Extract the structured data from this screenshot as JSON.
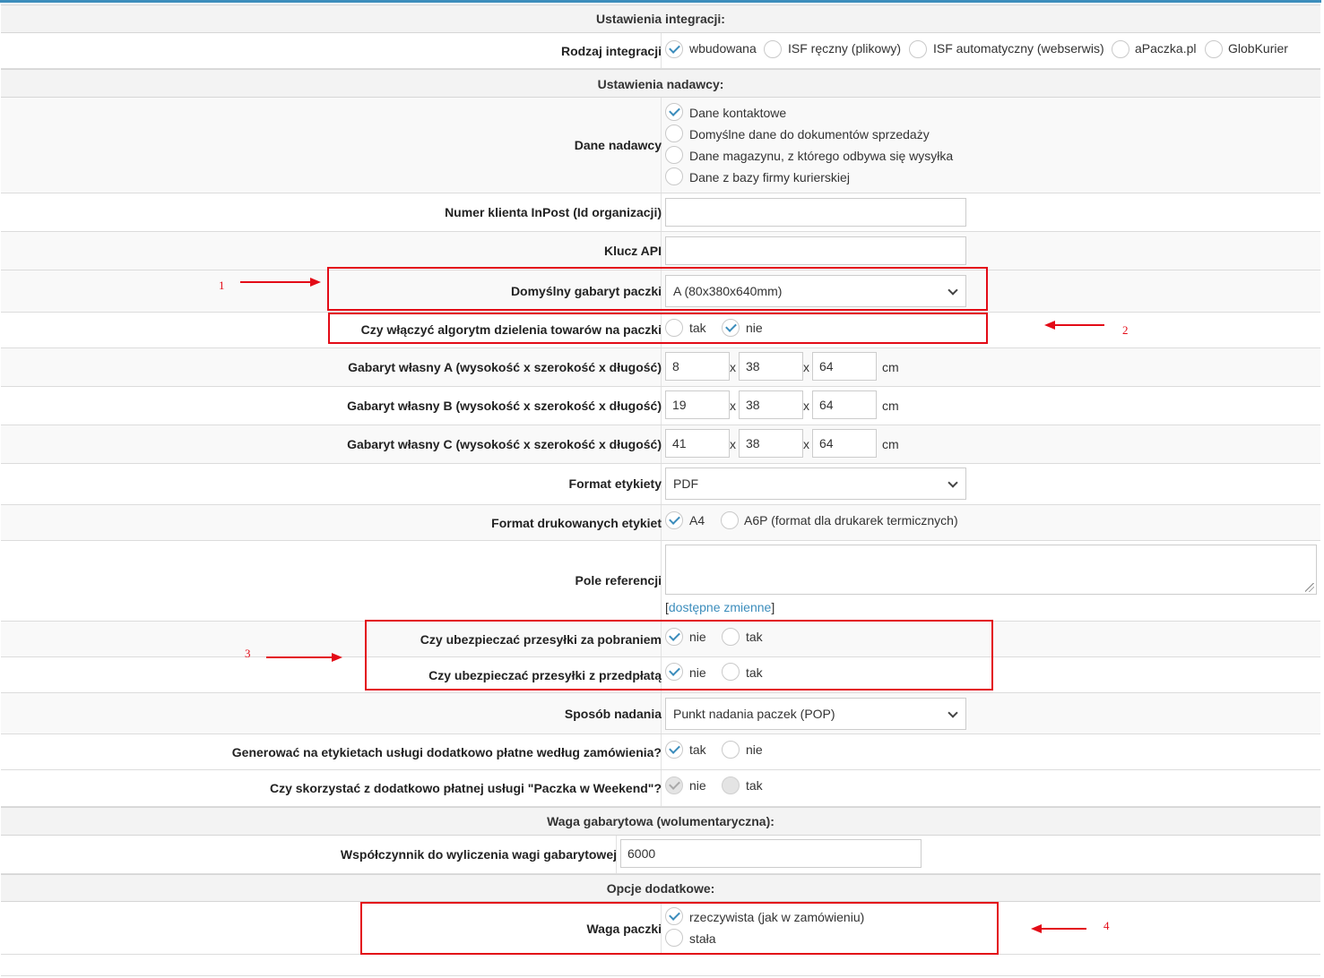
{
  "sections": {
    "integration": "Ustawienia integracji:",
    "sender": "Ustawienia nadawcy:",
    "dim_weight": "Waga gabarytowa (wolumentaryczna):",
    "extra": "Opcje dodatkowe:"
  },
  "integration_type": {
    "label": "Rodzaj integracji",
    "options": [
      "wbudowana",
      "ISF ręczny (plikowy)",
      "ISF automatyczny (webserwis)",
      "aPaczka.pl",
      "GlobKurier"
    ],
    "selected": "wbudowana"
  },
  "sender_data": {
    "label": "Dane nadawcy",
    "options": [
      "Dane kontaktowe",
      "Domyślne dane do dokumentów sprzedaży",
      "Dane magazynu, z którego odbywa się wysyłka",
      "Dane z bazy firmy kurierskiej"
    ],
    "selected": "Dane kontaktowe"
  },
  "client_number": {
    "label": "Numer klienta InPost (Id organizacji)",
    "value": ""
  },
  "api_key": {
    "label": "Klucz API",
    "value": ""
  },
  "default_size": {
    "label": "Domyślny gabaryt paczki",
    "value": "A (80x380x640mm)"
  },
  "split_algorithm": {
    "label": "Czy włączyć algorytm dzielenia towarów na paczki",
    "options": [
      "tak",
      "nie"
    ],
    "selected": "nie"
  },
  "custom_sizes": {
    "separator": "x",
    "unit": "cm",
    "items": [
      {
        "label": "Gabaryt własny A (wysokość x szerokość x długość)",
        "values": [
          "8",
          "38",
          "64"
        ]
      },
      {
        "label": "Gabaryt własny B (wysokość x szerokość x długość)",
        "values": [
          "19",
          "38",
          "64"
        ]
      },
      {
        "label": "Gabaryt własny C (wysokość x szerokość x długość)",
        "values": [
          "41",
          "38",
          "64"
        ]
      }
    ]
  },
  "label_format": {
    "label": "Format etykiety",
    "value": "PDF"
  },
  "print_format": {
    "label": "Format drukowanych etykiet",
    "options": [
      "A4",
      "A6P (format dla drukarek termicznych)"
    ],
    "selected": "A4"
  },
  "reference": {
    "label": "Pole referencji",
    "value": "",
    "link_open": "[",
    "link_text": "dostępne zmienne",
    "link_close": "]"
  },
  "insure_cod": {
    "label": "Czy ubezpieczać przesyłki za pobraniem",
    "options": [
      "nie",
      "tak"
    ],
    "selected": "nie"
  },
  "insure_prepaid": {
    "label": "Czy ubezpieczać przesyłki z przedpłatą",
    "options": [
      "nie",
      "tak"
    ],
    "selected": "nie"
  },
  "send_method": {
    "label": "Sposób nadania",
    "value": "Punkt nadania paczek (POP)"
  },
  "paid_services": {
    "label": "Generować na etykietach usługi dodatkowo płatne według zamówienia?",
    "options": [
      "tak",
      "nie"
    ],
    "selected": "tak"
  },
  "weekend": {
    "label": "Czy skorzystać z dodatkowo płatnej usługi \"Paczka w Weekend\"?",
    "options": [
      "nie",
      "tak"
    ],
    "selected": "nie"
  },
  "dim_factor": {
    "label": "Współczynnik do wyliczenia wagi gabarytowej",
    "value": "6000"
  },
  "package_weight": {
    "label": "Waga paczki",
    "options": [
      "rzeczywista (jak w zamówieniu)",
      "stała"
    ],
    "selected": "rzeczywista (jak w zamówieniu)"
  },
  "annotations": [
    "1",
    "2",
    "3",
    "4"
  ],
  "colors": {
    "accent": "#3c8dbc",
    "annotation": "#e30b17"
  }
}
